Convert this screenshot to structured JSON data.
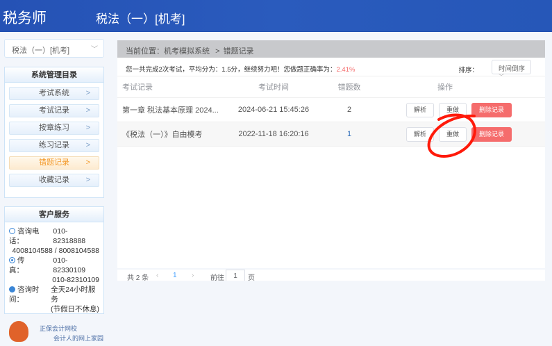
{
  "header": {
    "logo": "税务师",
    "title": "税法（一）[机考]",
    "bg_color": "#2a58ba"
  },
  "sidebar": {
    "subject_select": {
      "value": "税法（一）[机考]",
      "icon": "chevron-down-icon"
    },
    "menu": {
      "title": "系统管理目录",
      "items": [
        {
          "label": "考试系统",
          "active": false
        },
        {
          "label": "考试记录",
          "active": false
        },
        {
          "label": "按章练习",
          "active": false
        },
        {
          "label": "练习记录",
          "active": false
        },
        {
          "label": "错题记录",
          "active": true
        },
        {
          "label": "收藏记录",
          "active": false
        }
      ],
      "active_color": "#f39a2b"
    },
    "service": {
      "title": "客户服务",
      "phone_label": "咨询电话：",
      "phone1": "010-82318888",
      "phone2": "4008104588 / 8008104588",
      "fax_label": "传　　真：",
      "fax1": "010-82330109",
      "fax2": "010-82310109",
      "hours_label": "咨询时间：",
      "hours1": "全天24小时服务",
      "hours2": "(节假日不休息)",
      "promo1": "正保会计网校",
      "promo2": "会计人的网上家园"
    }
  },
  "main": {
    "breadcrumb": {
      "prefix": "当前位置：",
      "items": [
        "机考模拟系统",
        "错题记录"
      ],
      "sep": ">"
    },
    "summary": {
      "text": "您一共完成2次考试，平均分为：1.5分，继续努力吧！您做题正确率为：",
      "rate": "2.41%",
      "rate_color": "#f56c6c"
    },
    "sort": {
      "label": "排序：",
      "value": "时间倒序"
    },
    "table": {
      "headers": [
        "考试记录",
        "考试时间",
        "错题数",
        "操作"
      ],
      "rows": [
        {
          "name": "第一章 税法基本原理 2024...",
          "time": "2024-06-21 15:45:26",
          "count": "2"
        },
        {
          "name": "《税法（一）》自由模考",
          "time": "2022-11-18 16:20:16",
          "count": "1"
        }
      ],
      "actions": {
        "analyze": "解析",
        "redo": "重做",
        "delete": "删除记录"
      }
    },
    "pagination": {
      "total": "共 2 条",
      "prev": "‹",
      "page": "1",
      "next": "›",
      "goto": "前往",
      "goto_value": "1",
      "page_unit": "页"
    }
  },
  "annotation": {
    "color": "#ff1a0a"
  }
}
